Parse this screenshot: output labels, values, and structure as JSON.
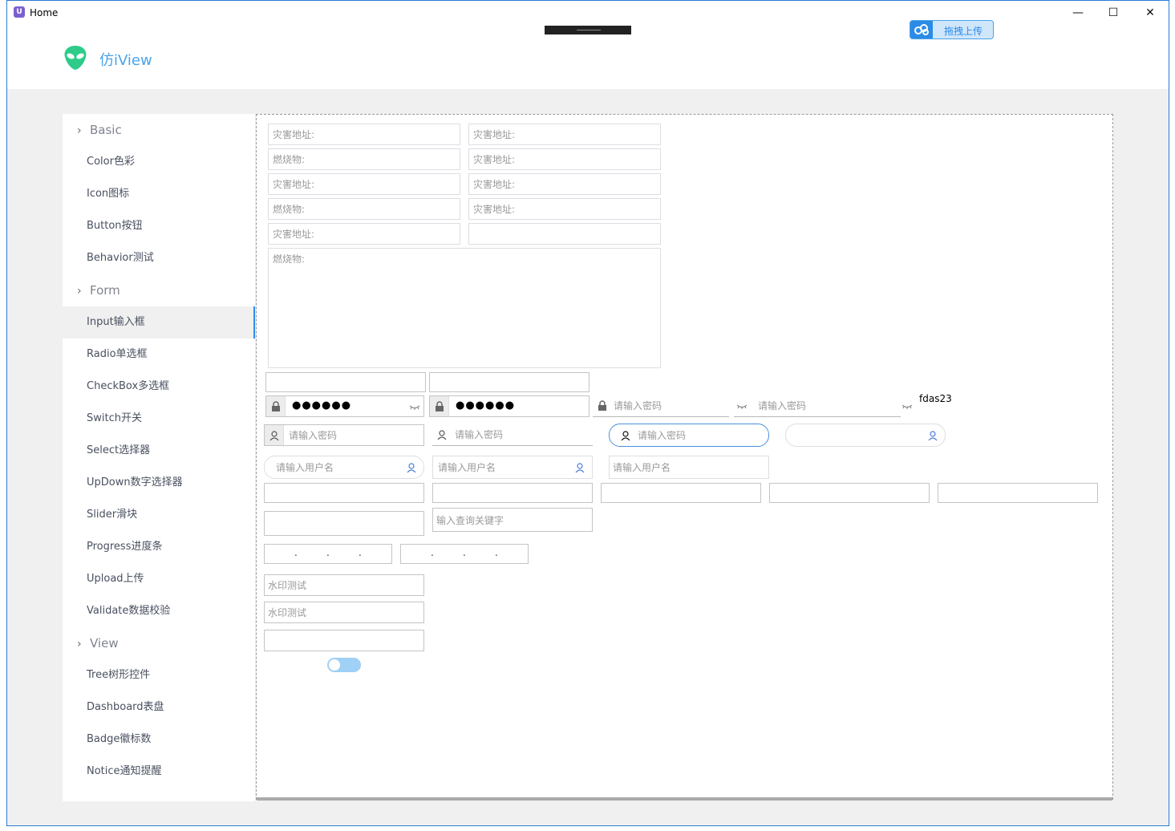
{
  "window": {
    "title": "Home",
    "app_icon_text": "U",
    "minimize": "—",
    "maximize": "☐",
    "close": "✕"
  },
  "upload_chip": {
    "label": "拖拽上传"
  },
  "brand": {
    "name": "仿iView",
    "accent": "#4aa3e8",
    "logo_color": "#2ecb8a"
  },
  "sidebar": {
    "groups": [
      {
        "label": "Basic",
        "items": [
          "Color色彩",
          "Icon图标",
          "Button按钮",
          "Behavior测试"
        ]
      },
      {
        "label": "Form",
        "items": [
          "Input输入框",
          "Radio单选框",
          "CheckBox多选框",
          "Switch开关",
          "Select选择器",
          "UpDown数字选择器",
          "Slider滑块",
          "Progress进度条",
          "Upload上传",
          "Validate数据校验"
        ]
      },
      {
        "label": "View",
        "items": [
          "Tree树形控件",
          "Dashboard表盘",
          "Badge徽标数",
          "Notice通知提醒"
        ]
      }
    ],
    "active_item": "Input输入框"
  },
  "form": {
    "grid_left": [
      "灾害地址:",
      "燃烧物:",
      "灾害地址:",
      "燃烧物:",
      "灾害地址:"
    ],
    "grid_right": [
      "灾害地址:",
      "灾害地址:",
      "灾害地址:",
      "灾害地址:",
      ""
    ],
    "textarea_label": "燃烧物:",
    "password_value": "●●●●●●",
    "pw_placeholder": "请输入密码",
    "user_placeholder": "请输入用户名",
    "fdas_text": "fdas23",
    "search_placeholder": "输入查询关键字",
    "watermark_placeholder": "水印测试",
    "ip_separator": "."
  }
}
